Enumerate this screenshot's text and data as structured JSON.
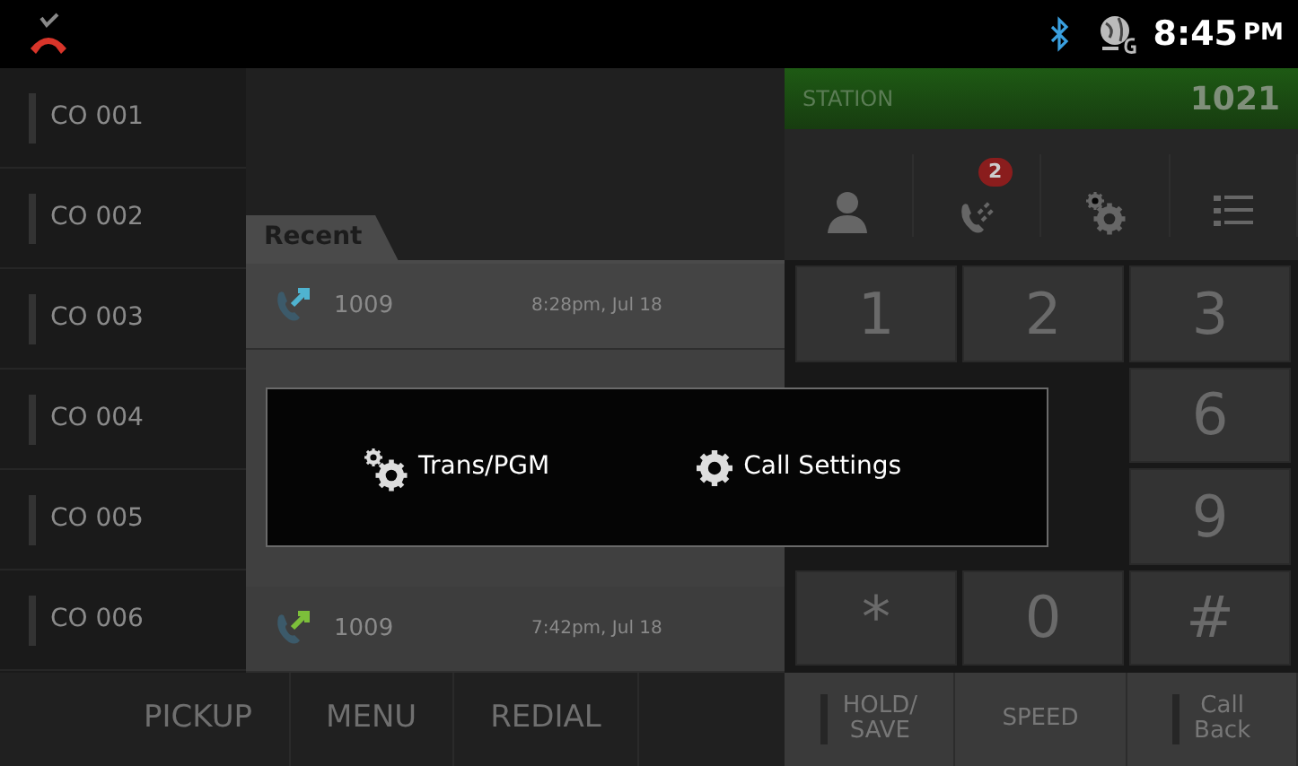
{
  "status_bar": {
    "time": "8:45",
    "meridiem": "PM"
  },
  "co_lines": [
    {
      "label": "CO 001"
    },
    {
      "label": "CO 002"
    },
    {
      "label": "CO 003"
    },
    {
      "label": "CO 004"
    },
    {
      "label": "CO 005"
    },
    {
      "label": "CO 006"
    }
  ],
  "recent": {
    "title": "Recent",
    "rows": [
      {
        "kind": "outgoing",
        "number": "1009",
        "time": "8:28pm, Jul 18"
      },
      {
        "kind": "incoming",
        "number": "1009",
        "time": "7:42pm, Jul 18"
      }
    ]
  },
  "station": {
    "label": "STATION",
    "number": "1021"
  },
  "toolbar": [
    {
      "kind": "contacts"
    },
    {
      "kind": "calls",
      "badge": "2"
    },
    {
      "kind": "settings"
    },
    {
      "kind": "list"
    }
  ],
  "keypad": [
    [
      {
        "label": "1"
      },
      {
        "label": "2"
      },
      {
        "label": "3"
      }
    ],
    [
      {
        "label": "6"
      }
    ],
    [
      {
        "label": "9"
      }
    ],
    [
      {
        "label": "*"
      },
      {
        "label": "0"
      },
      {
        "label": "#"
      }
    ]
  ],
  "bottom_left": [
    "PICKUP",
    "MENU",
    "REDIAL"
  ],
  "bottom_right": [
    {
      "label": "HOLD/\nSAVE",
      "lamp": true
    },
    {
      "label": "SPEED",
      "lamp": false
    },
    {
      "label": "Call\nBack",
      "lamp": true
    }
  ],
  "popup": [
    {
      "kind": "gears",
      "label": "Trans/PGM"
    },
    {
      "kind": "gear",
      "label": "Call Settings"
    }
  ]
}
